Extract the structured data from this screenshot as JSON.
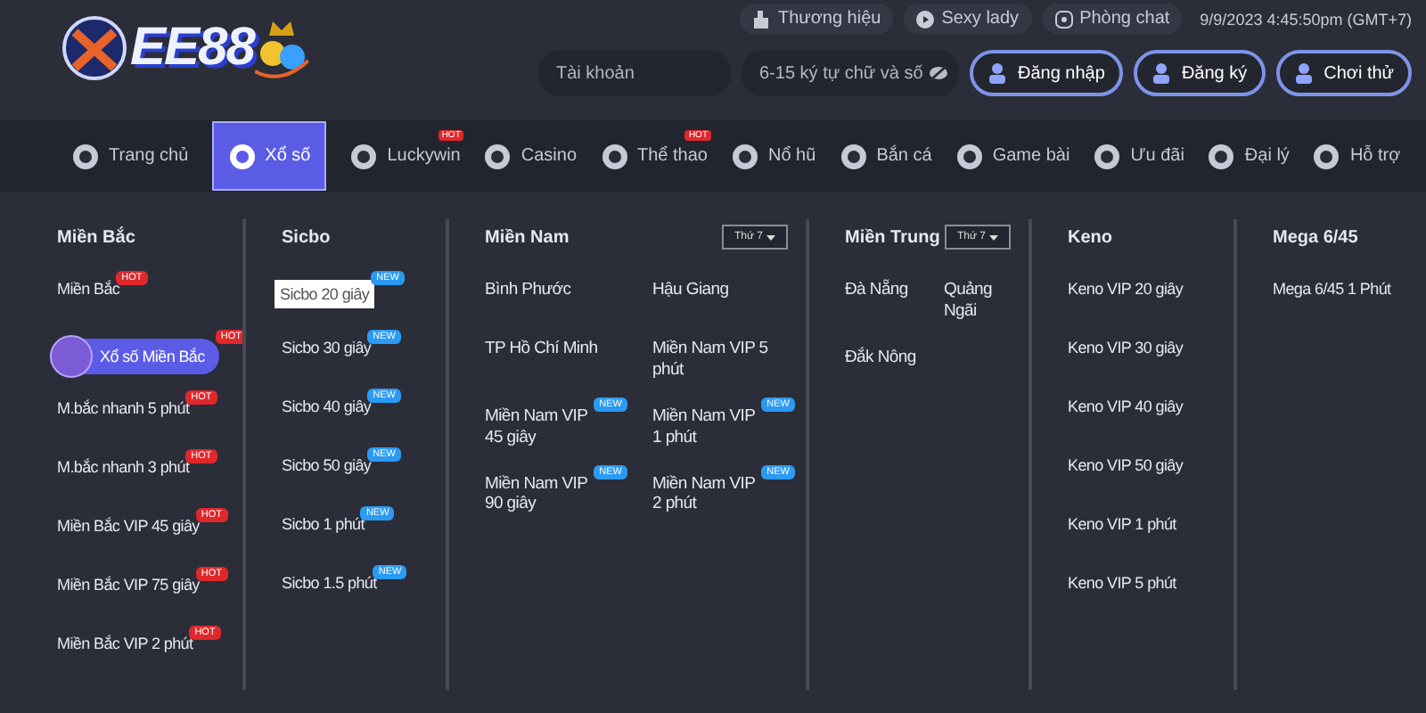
{
  "logo": {
    "text": "EE88"
  },
  "top_links": [
    {
      "label": "Thương hiệu"
    },
    {
      "label": "Sexy lady"
    },
    {
      "label": "Phòng chat"
    }
  ],
  "datetime": "9/9/2023 4:45:50pm  (GMT+7)",
  "login": {
    "username_placeholder": "Tài khoản",
    "password_placeholder": "6-15 ký tự chữ và số",
    "buttons": [
      "Đăng nhập",
      "Đăng ký",
      "Chơi thử"
    ]
  },
  "nav": [
    {
      "label": "Trang chủ",
      "selected": false
    },
    {
      "label": "Xổ số",
      "selected": true
    },
    {
      "label": "Luckywin",
      "selected": false,
      "badge": "HOT"
    },
    {
      "label": "Casino",
      "selected": false
    },
    {
      "label": "Thể thao",
      "selected": false,
      "badge": "HOT"
    },
    {
      "label": "Nổ hũ",
      "selected": false
    },
    {
      "label": "Bắn cá",
      "selected": false
    },
    {
      "label": "Game bài",
      "selected": false
    },
    {
      "label": "Ưu đãi",
      "selected": false
    },
    {
      "label": "Đại lý",
      "selected": false
    },
    {
      "label": "Hỗ trợ",
      "selected": false
    }
  ],
  "columns": [
    {
      "title": "Miền Bắc",
      "kind": "list",
      "items": [
        {
          "label": "Miền Bắc",
          "badge": "HOT",
          "featured": false
        },
        {
          "label": "Xổ số Miền Bắc",
          "badge": "HOT",
          "featured": true
        },
        {
          "label": "M.bắc nhanh 5 phút",
          "badge": "HOT",
          "featured": false
        },
        {
          "label": "M.bắc nhanh 3 phút",
          "badge": "HOT",
          "featured": false
        },
        {
          "label": "Miền Bắc VIP 45 giây",
          "badge": "HOT",
          "featured": false
        },
        {
          "label": "Miền Bắc VIP 75 giây",
          "badge": "HOT",
          "featured": false
        },
        {
          "label": "Miền Bắc VIP 2 phút",
          "badge": "HOT",
          "featured": false
        }
      ]
    },
    {
      "title": "Sicbo",
      "kind": "list",
      "items": [
        {
          "label": "Sicbo 20 giây",
          "badge": "NEW",
          "selected": true
        },
        {
          "label": "Sicbo 30 giây",
          "badge": "NEW",
          "selected": false
        },
        {
          "label": "Sicbo 40 giây",
          "badge": "NEW",
          "selected": false
        },
        {
          "label": "Sicbo 50 giây",
          "badge": "NEW",
          "selected": false
        },
        {
          "label": "Sicbo 1 phút",
          "badge": "NEW",
          "selected": false
        },
        {
          "label": "Sicbo 1.5 phút",
          "badge": "NEW",
          "selected": false
        }
      ]
    },
    {
      "title": "Miền Nam",
      "kind": "grid",
      "dropdown": "Thứ 7",
      "items": [
        {
          "label": "Bình Phước"
        },
        {
          "label": "Hậu Giang"
        },
        {
          "label": "TP Hồ Chí Minh"
        },
        {
          "label": "Miền Nam VIP 5 phút"
        },
        {
          "label": "Miền Nam VIP 45 giây",
          "badge": "NEW"
        },
        {
          "label": "Miền Nam VIP 1 phút",
          "badge": "NEW"
        },
        {
          "label": "Miền Nam VIP 90 giây",
          "badge": "NEW"
        },
        {
          "label": "Miền Nam VIP 2 phút",
          "badge": "NEW"
        }
      ]
    },
    {
      "title": "Miền Trung",
      "kind": "grid",
      "dropdown": "Thứ 7",
      "items": [
        {
          "label": "Đà Nẵng"
        },
        {
          "label": "Quảng Ngãi"
        },
        {
          "label": "Đắk Nông"
        }
      ]
    },
    {
      "title": "Keno",
      "kind": "list",
      "items": [
        {
          "label": "Keno VIP 20 giây"
        },
        {
          "label": "Keno VIP 30 giây"
        },
        {
          "label": "Keno VIP 40 giây"
        },
        {
          "label": "Keno VIP 50 giây"
        },
        {
          "label": "Keno VIP 1 phút"
        },
        {
          "label": "Keno VIP 5 phút"
        }
      ]
    },
    {
      "title": "Mega 6/45",
      "kind": "list",
      "items": [
        {
          "label": "Mega 6/45 1 Phút"
        }
      ]
    }
  ]
}
